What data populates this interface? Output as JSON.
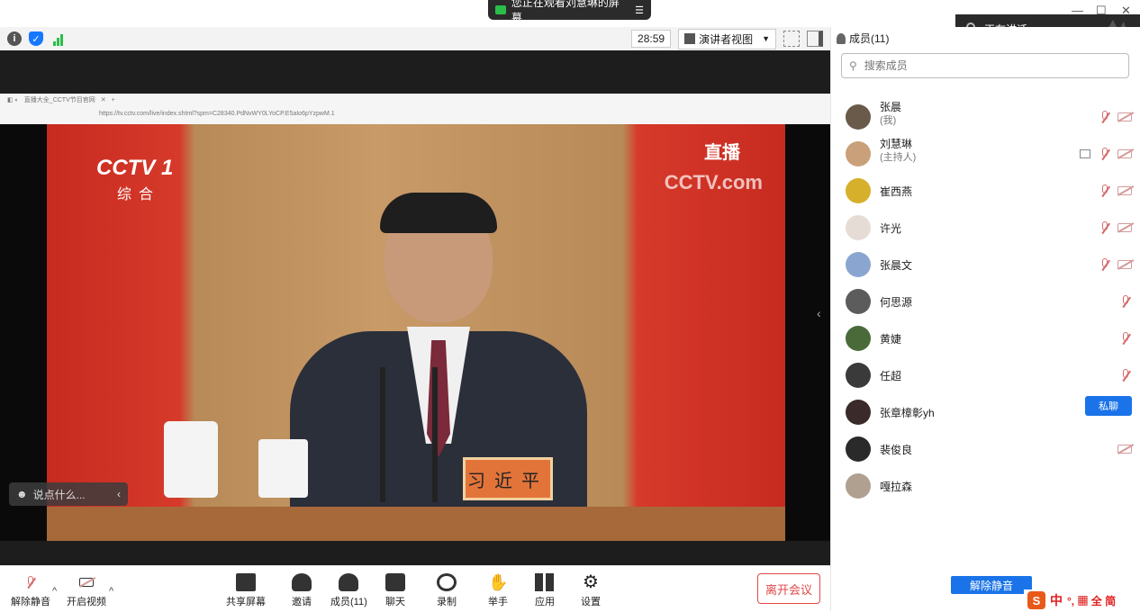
{
  "banner": {
    "text": "您正在观看刘慧琳的屏幕",
    "menu_icon": "list-icon"
  },
  "speaking": {
    "label": "正在讲话:"
  },
  "toolbar": {
    "timer": "28:59",
    "view_label": "演讲者视图"
  },
  "shared_screen": {
    "browser_url": "https://tv.cctv.com/live/index.shtml?spm=C28340.PdNvWY0LYoCP.E5aIo6pYzpwM.1",
    "tab_label": "直播大全_CCTV节目官网",
    "channel_logo": "CCTV 1",
    "channel_name": "综合",
    "live_label": "直播",
    "watermark": "CCTV.com",
    "nameplate": "习近平",
    "chat_placeholder": "说点什么..."
  },
  "bottom": {
    "unmute": "解除静音",
    "start_video": "开启视频",
    "share_screen": "共享屏幕",
    "invite": "邀请",
    "members": "成员(11)",
    "chat": "聊天",
    "record": "录制",
    "raise_hand": "举手",
    "apps": "应用",
    "settings": "设置",
    "leave": "离开会议"
  },
  "panel": {
    "title": "成员(11)",
    "search_placeholder": "搜索成员",
    "private_chat": "私聊",
    "unmute_button": "解除静音",
    "members": [
      {
        "name": "张晨",
        "role": "(我)",
        "avatar_color": "#6a5a4a"
      },
      {
        "name": "刘慧琳",
        "role": "(主持人)",
        "avatar_color": "#c9a07a"
      },
      {
        "name": "崔西燕",
        "role": "",
        "avatar_color": "#d6b02a"
      },
      {
        "name": "许光",
        "role": "",
        "avatar_color": "#e6dcd6"
      },
      {
        "name": "张晨文",
        "role": "",
        "avatar_color": "#8aa6d0"
      },
      {
        "name": "何思源",
        "role": "",
        "avatar_color": "#5c5c5c"
      },
      {
        "name": "黄婕",
        "role": "",
        "avatar_color": "#4a6a3a"
      },
      {
        "name": "任超",
        "role": "",
        "avatar_color": "#3a3a3a"
      },
      {
        "name": "张章樟彰yh",
        "role": "",
        "avatar_color": "#3a2a2a"
      },
      {
        "name": "裴俊良",
        "role": "",
        "avatar_color": "#2a2a2a"
      },
      {
        "name": "嘎拉森",
        "role": "",
        "avatar_color": "#b0a090"
      }
    ]
  },
  "ime": {
    "label": "中",
    "extra": "°, ▦ 全 简"
  }
}
